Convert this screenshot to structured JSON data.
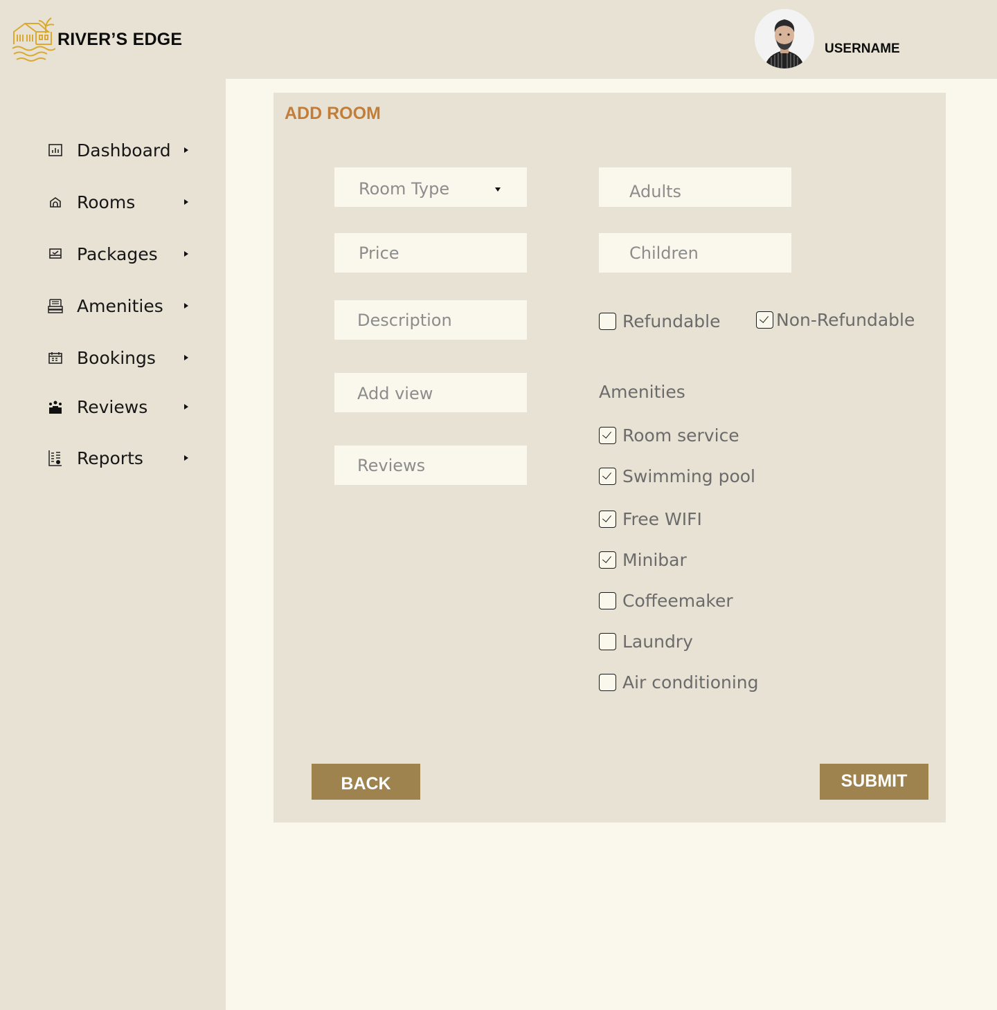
{
  "header": {
    "brand": "RIVER’S EDGE",
    "username": "USERNAME",
    "logo_icon": "hotel-logo-icon",
    "avatar_icon": "user-avatar"
  },
  "sidebar": {
    "items": [
      {
        "label": "Dashboard",
        "icon": "dashboard-icon"
      },
      {
        "label": "Rooms",
        "icon": "home-icon"
      },
      {
        "label": "Packages",
        "icon": "package-icon"
      },
      {
        "label": "Amenities",
        "icon": "amenities-icon"
      },
      {
        "label": "Bookings",
        "icon": "calendar-icon"
      },
      {
        "label": "Reviews",
        "icon": "reviews-icon"
      },
      {
        "label": "Reports",
        "icon": "reports-icon"
      }
    ]
  },
  "form": {
    "title": "ADD ROOM",
    "fields": {
      "room_type": "Room Type",
      "price": "Price",
      "description": "Description",
      "add_view": "Add view",
      "reviews": "Reviews",
      "adults": "Adults",
      "children": "Children"
    },
    "refund": {
      "refundable": {
        "label": "Refundable",
        "checked": false
      },
      "non_refundable": {
        "label": "Non-Refundable",
        "checked": true
      }
    },
    "amenities_title": "Amenities",
    "amenities": [
      {
        "label": "Room service",
        "checked": true
      },
      {
        "label": "Swimming pool",
        "checked": true
      },
      {
        "label": "Free WIFI",
        "checked": true
      },
      {
        "label": "Minibar",
        "checked": true
      },
      {
        "label": "Coffeemaker",
        "checked": false
      },
      {
        "label": "Laundry",
        "checked": false
      },
      {
        "label": "Air conditioning",
        "checked": false
      }
    ],
    "back_label": "BACK",
    "submit_label": "SUBMIT"
  },
  "colors": {
    "background": "#e8e2d4",
    "content": "#faf8ec",
    "accent_title": "#c27d38",
    "button": "#9f834f",
    "logo": "#d9a932"
  }
}
